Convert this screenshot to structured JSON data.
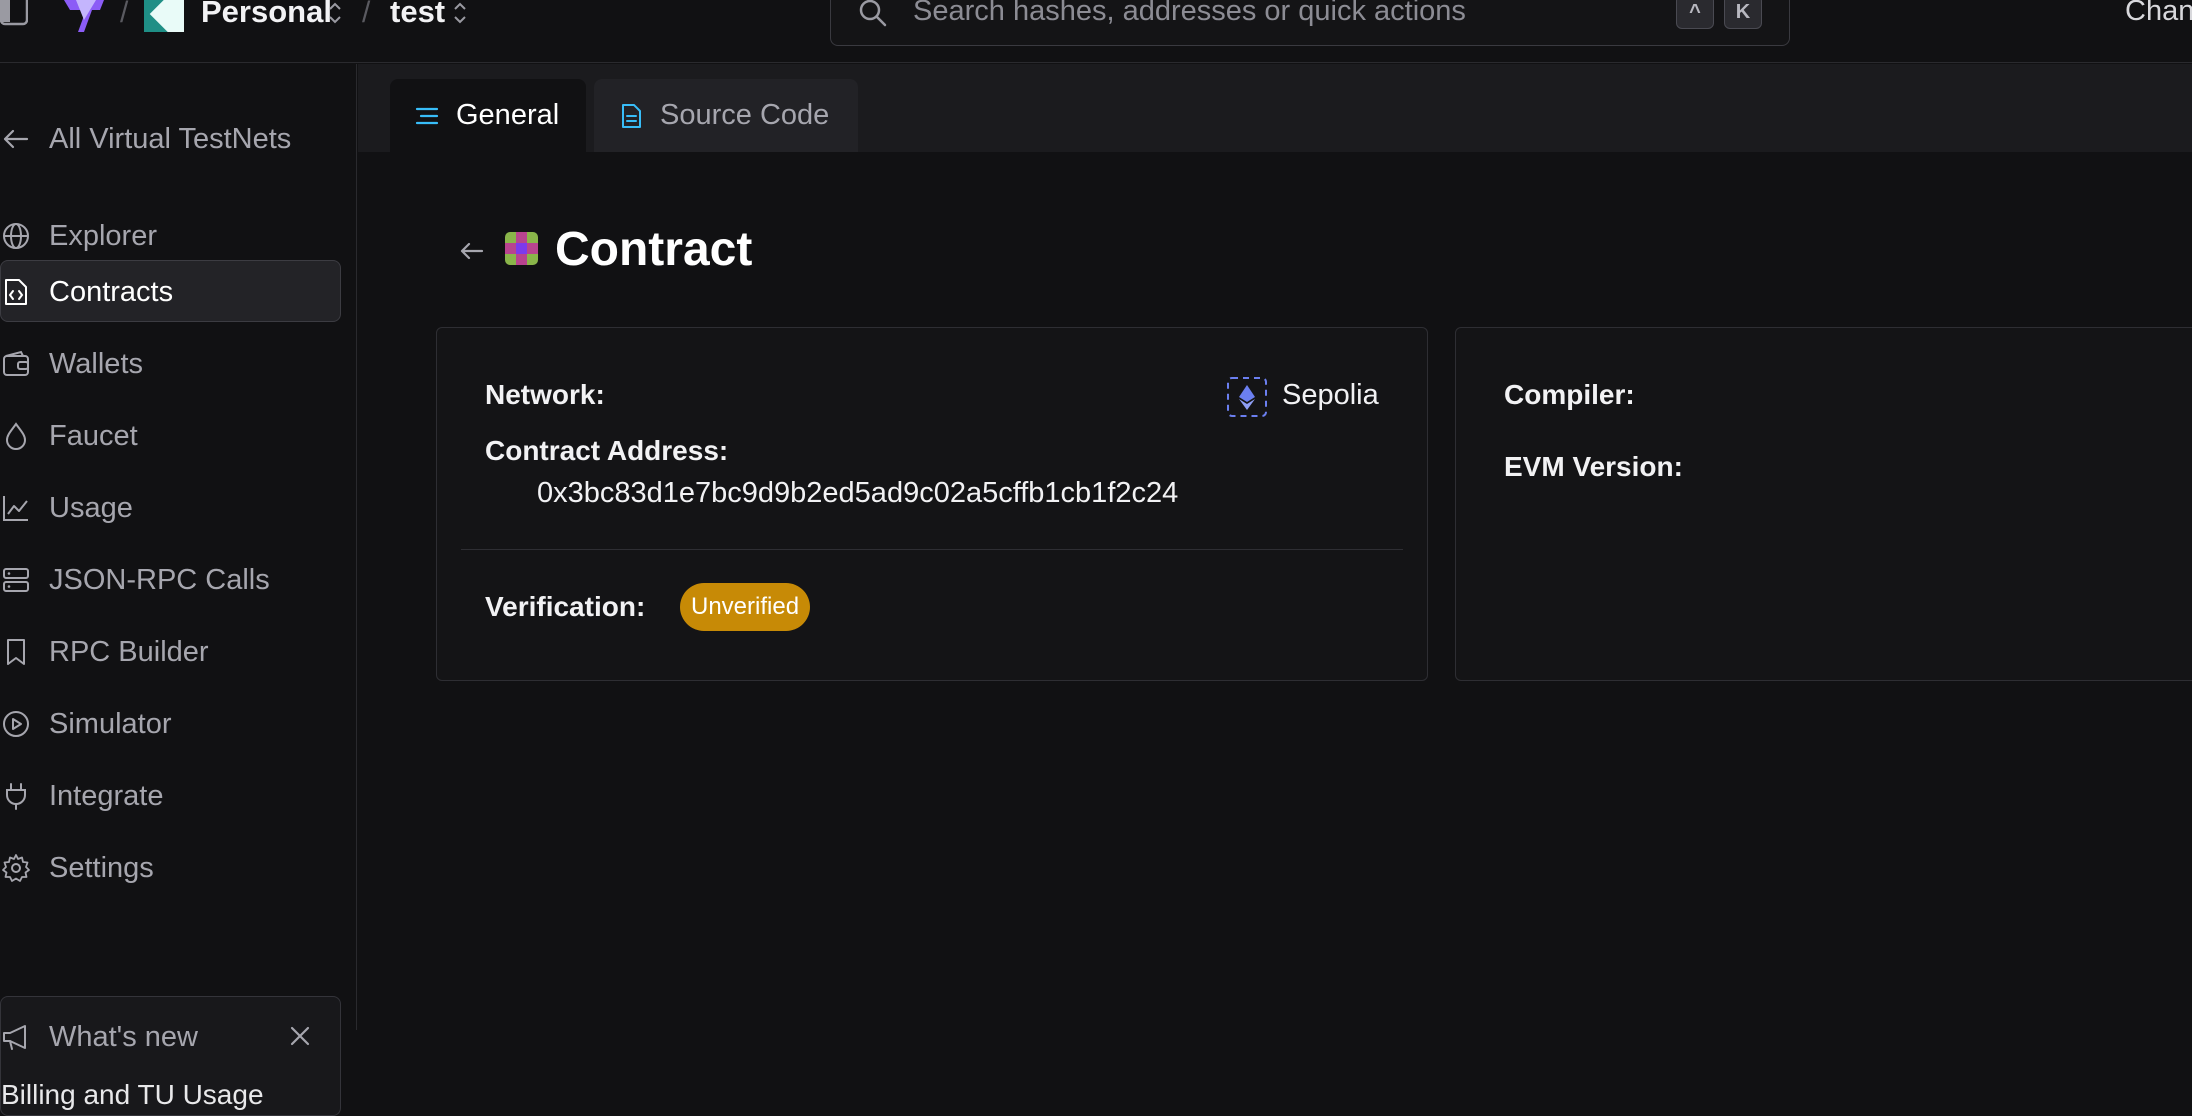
{
  "topbar": {
    "workspace": "Personal",
    "project": "test",
    "separator": "/",
    "search_placeholder": "Search hashes, addresses or quick actions",
    "shortcut_modifier": "^",
    "shortcut_key": "K",
    "right_text": "Chan"
  },
  "sidebar": {
    "back_label": "All Virtual TestNets",
    "items": [
      {
        "label": "Explorer"
      },
      {
        "label": "Contracts"
      },
      {
        "label": "Wallets"
      },
      {
        "label": "Faucet"
      },
      {
        "label": "Usage"
      },
      {
        "label": "JSON-RPC Calls"
      },
      {
        "label": "RPC Builder"
      },
      {
        "label": "Simulator"
      },
      {
        "label": "Integrate"
      },
      {
        "label": "Settings"
      }
    ],
    "active_item": "Contracts",
    "whats_new": {
      "label": "What's new",
      "text": "Billing and TU Usage"
    }
  },
  "tabs": [
    {
      "label": "General"
    },
    {
      "label": "Source Code"
    }
  ],
  "active_tab": "General",
  "page": {
    "title": "Contract",
    "network_label": "Network:",
    "network_value": "Sepolia",
    "address_label": "Contract Address:",
    "address_value": "0x3bc83d1e7bc9d9b2ed5ad9c02a5cffb1cb1f2c24",
    "verification_label": "Verification:",
    "verification_value": "Unverified",
    "compiler_label": "Compiler:",
    "evm_label": "EVM Version:"
  },
  "colors": {
    "accent": "#38bdf8",
    "badge_warning": "#c78a06",
    "eth": "#6b7ff0"
  }
}
